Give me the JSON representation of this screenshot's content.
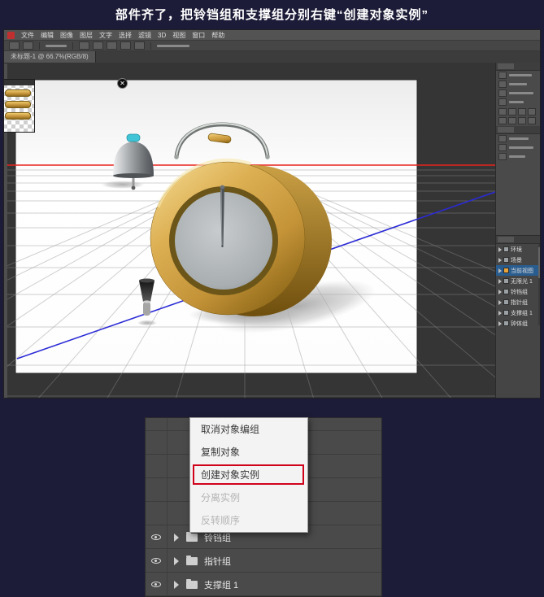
{
  "title": "部件齐了，把铃铛组和支撑组分别右键“创建对象实例”",
  "menubar": {
    "items": [
      "文件",
      "编辑",
      "图像",
      "图层",
      "文字",
      "选择",
      "滤镜",
      "3D",
      "视图",
      "窗口",
      "帮助"
    ]
  },
  "doc_tab": {
    "label": "未标题-1 @ 66.7%(RGB/8)"
  },
  "right_panel": {
    "list_rows": [
      {
        "label": "环境"
      },
      {
        "label": "场景"
      },
      {
        "label": "当前视图",
        "selected": true
      },
      {
        "label": "无限光 1"
      },
      {
        "label": "铃铛组"
      },
      {
        "label": "指针组"
      },
      {
        "label": "支撑组 1"
      },
      {
        "label": "钟体组"
      }
    ]
  },
  "context_menu": {
    "items": [
      {
        "label": "取消对象编组",
        "enabled": true
      },
      {
        "label": "复制对象",
        "enabled": true
      },
      {
        "label": "创建对象实例",
        "enabled": true,
        "highlighted": true
      },
      {
        "label": "分离实例",
        "enabled": false
      },
      {
        "label": "反转顺序",
        "enabled": false
      }
    ]
  },
  "layers_panel": {
    "rows": [
      "铃铛组",
      "指针组",
      "支撑组 1"
    ]
  },
  "icons": {
    "close": "✕"
  },
  "colors": {
    "highlight_red": "#d0021b",
    "gold": "#d9ab4f",
    "axis_red": "#e8231d",
    "axis_blue": "#2b2bd6",
    "bell_cap_cyan": "#41c4d5"
  }
}
